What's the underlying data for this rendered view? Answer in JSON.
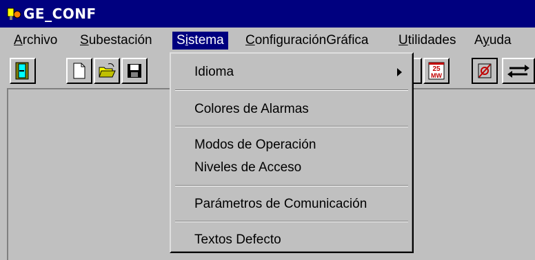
{
  "window": {
    "title": "GE_CONF"
  },
  "menubar": {
    "items": [
      {
        "label": "Archivo",
        "mnemonic": "A"
      },
      {
        "label": "Subestación",
        "mnemonic": "S"
      },
      {
        "label": "Sistema",
        "mnemonic": "i"
      },
      {
        "label": "ConfiguraciónGráfica",
        "mnemonic": "C"
      },
      {
        "label": "Utilidades",
        "mnemonic": "U"
      },
      {
        "label": "Ayuda",
        "mnemonic": "y"
      }
    ],
    "active": "Sistema"
  },
  "toolbar": {
    "buttons": [
      {
        "icon": "exit-door-icon"
      },
      {
        "icon": "new-document-icon"
      },
      {
        "icon": "open-folder-icon"
      },
      {
        "icon": "save-disk-icon"
      },
      {
        "icon": "partial-button"
      },
      {
        "icon": "calendar-25-mw-icon",
        "text_top": "25",
        "text_bottom": "MW"
      },
      {
        "icon": "crossed-symbol-icon"
      },
      {
        "icon": "exchange-arrows-icon"
      }
    ]
  },
  "sistema_menu": {
    "items": [
      {
        "label": "Idioma",
        "submenu": true
      },
      {
        "label": "Colores de Alarmas"
      },
      {
        "label": "Modos de Operación"
      },
      {
        "label": "Niveles de Acceso"
      },
      {
        "label": "Parámetros de Comunicación"
      },
      {
        "label": "Textos Defecto"
      }
    ]
  },
  "colors": {
    "titlebar": "#00007f",
    "face": "#c0c0c0",
    "highlight": "#00007f"
  }
}
